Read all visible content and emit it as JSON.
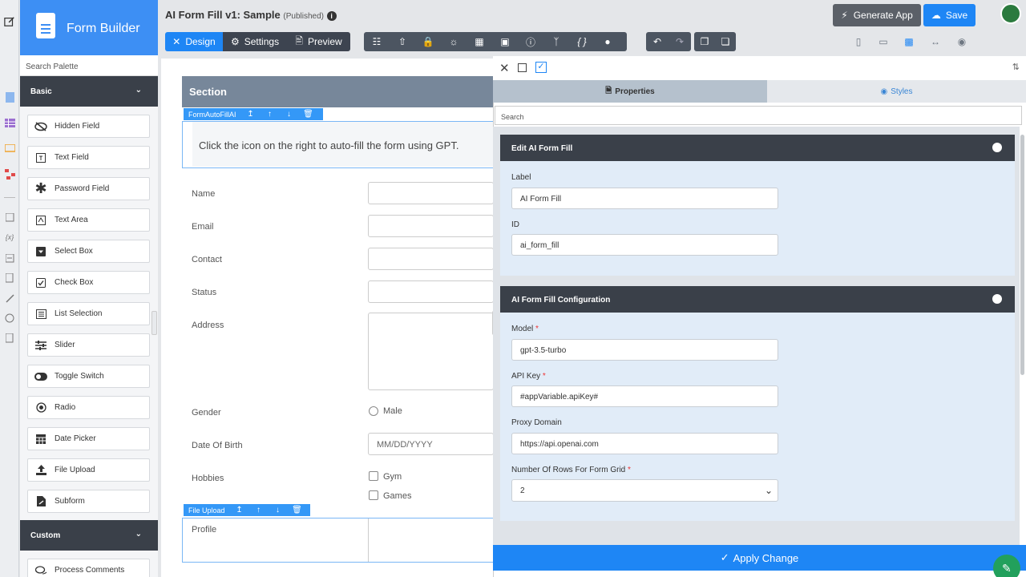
{
  "app": {
    "name": "Form Builder",
    "title": "AI Form Fill v1: Sample",
    "status": "(Published)"
  },
  "toolbar": {
    "design": "Design",
    "settings": "Settings",
    "preview": "Preview",
    "generate": "Generate App",
    "save": "Save"
  },
  "palette": {
    "search_placeholder": "Search Palette",
    "basic_label": "Basic",
    "custom_label": "Custom",
    "items": [
      "Hidden Field",
      "Text Field",
      "Password Field",
      "Text Area",
      "Select Box",
      "Check Box",
      "List Selection",
      "Slider",
      "Toggle Switch",
      "Radio",
      "Date Picker",
      "File Upload",
      "Subform"
    ],
    "custom_items": [
      "Process Comments"
    ]
  },
  "canvas": {
    "section": "Section",
    "ai_tool": "FormAutoFillAI",
    "ai_text": "Click the icon on the right to auto-fill the form using GPT.",
    "fields": [
      "Name",
      "Email",
      "Contact",
      "Status",
      "Address",
      "Gender",
      "Date Of Birth",
      "Hobbies"
    ],
    "gender_option": "Male",
    "dob_placeholder": "MM/DD/YYYY",
    "hobbies": [
      "Gym",
      "Games"
    ],
    "file_tool": "File Upload",
    "profile": "Profile"
  },
  "panel": {
    "tab_properties": "Properties",
    "tab_styles": "Styles",
    "search_placeholder": "Search",
    "edit_title": "Edit AI Form Fill",
    "label_label": "Label",
    "label_value": "AI Form Fill",
    "id_label": "ID",
    "id_value": "ai_form_fill",
    "config_title": "AI Form Fill Configuration",
    "model_label": "Model",
    "model_value": "gpt-3.5-turbo",
    "apikey_label": "API Key",
    "apikey_value": "#appVariable.apiKey#",
    "proxy_label": "Proxy Domain",
    "proxy_value": "https://api.openai.com",
    "rows_label": "Number Of Rows For Form Grid",
    "rows_value": "2",
    "required_mark": "*",
    "apply": "Apply Change"
  },
  "colors": {
    "primary": "#1e86f5",
    "dark": "#3a4049",
    "section": "#77879a"
  }
}
